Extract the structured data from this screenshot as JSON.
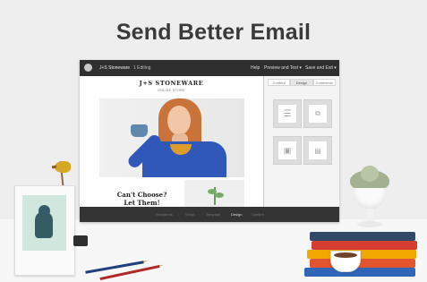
{
  "headline": "Send Better Email",
  "app": {
    "topbar": {
      "brand": "J+S Stoneware",
      "editing": "1 Editing",
      "help": "Help",
      "preview": "Preview and Test ▾",
      "save": "Save and Exit ▾"
    },
    "template": {
      "title": "J+S STONEWARE",
      "subtitle": "ONLINE STORE",
      "cta_line1": "Can't Choose?",
      "cta_line2": "Let Them!"
    },
    "sidebar": {
      "tabs": [
        "Content",
        "Design",
        "Comments"
      ],
      "active_tab": "Design",
      "blocks": [
        "text-block-icon",
        "social-block-icon",
        "image-block-icon",
        "image-text-block-icon"
      ]
    },
    "steps": [
      "Recipients",
      "Setup",
      "Template",
      "Design",
      "Confirm"
    ],
    "active_step": "Design"
  },
  "colors": {
    "accent": "#2f58b8",
    "dark_chrome": "#2f2f2f",
    "text": "#3a3a3a"
  }
}
